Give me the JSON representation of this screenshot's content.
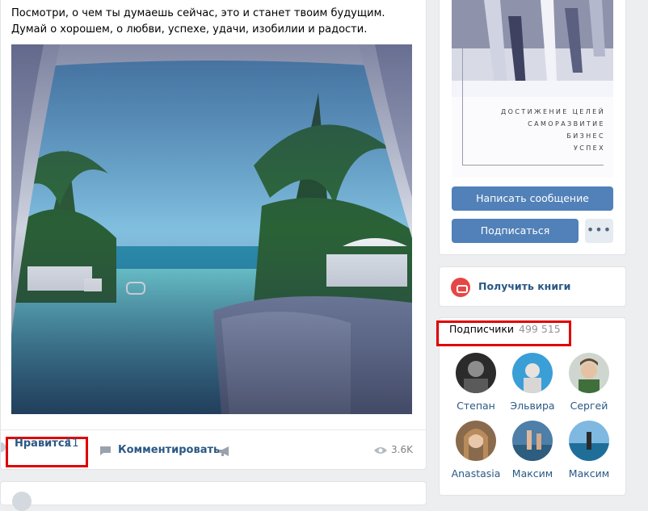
{
  "post": {
    "text": "Посмотри, о чем ты думаешь сейчас, это и станет твоим будущим. Думай о хорошем, о любви, успехе, удачи, изобилии и радости.",
    "like_label": "Нравится",
    "like_count": "11",
    "comment_label": "Комментировать",
    "views": "3.6K"
  },
  "profile": {
    "cover_lines": [
      "ДОСТИЖЕНИЕ ЦЕЛЕЙ",
      "САМОРАЗВИТИЕ",
      "БИЗНЕС",
      "УСПЕХ"
    ],
    "message_button": "Написать сообщение",
    "subscribe_button": "Подписаться",
    "more_button": "•••"
  },
  "books": {
    "label": "Получить книги"
  },
  "subscribers": {
    "title": "Подписчики",
    "count": "499 515",
    "members": [
      {
        "name": "Степан"
      },
      {
        "name": "Эльвира"
      },
      {
        "name": "Сергей"
      },
      {
        "name": "Anastasia"
      },
      {
        "name": "Максим"
      },
      {
        "name": "Максим"
      }
    ]
  },
  "colors": {
    "link": "#2a5885",
    "button": "#5181b8",
    "highlight_box": "#e00000",
    "background": "#edeef0"
  },
  "icons": [
    "heart-icon",
    "comment-icon",
    "share-icon",
    "views-icon",
    "books-icon",
    "more-icon"
  ]
}
